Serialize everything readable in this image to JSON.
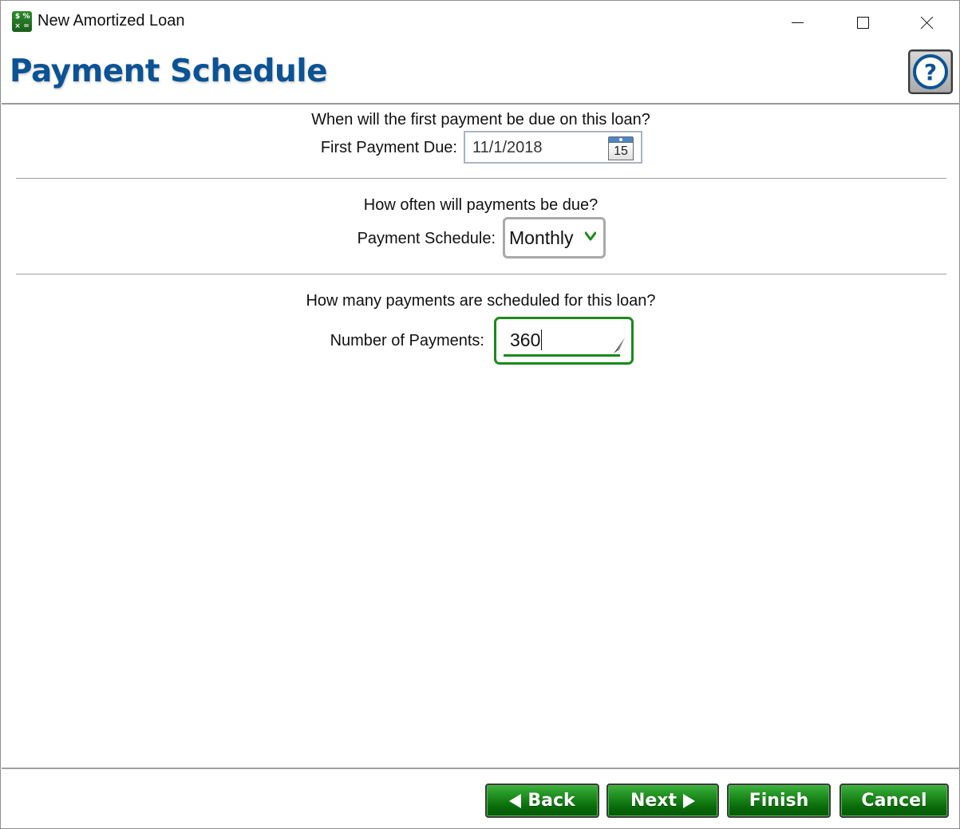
{
  "window": {
    "title": "New Amortized Loan",
    "app_icon_glyphs": [
      "$",
      "%",
      "×",
      "="
    ],
    "controls": {
      "minimize": "minimize-icon",
      "maximize": "maximize-icon",
      "close": "close-icon"
    }
  },
  "header": {
    "title": "Payment Schedule",
    "help_icon": "?"
  },
  "sections": {
    "first_payment": {
      "question": "When will the first payment be due on this loan?",
      "label": "First Payment Due:",
      "value": "11/1/2018",
      "calendar_icon_day": "15"
    },
    "schedule": {
      "question": "How often will payments be due?",
      "label": "Payment Schedule:",
      "selected": "Monthly"
    },
    "count": {
      "question": "How many payments are scheduled for this loan?",
      "label": "Number of Payments:",
      "value": "360"
    }
  },
  "footer": {
    "back_label": "Back",
    "next_label": "Next",
    "finish_label": "Finish",
    "cancel_label": "Cancel"
  },
  "colors": {
    "title_blue": "#0b5394",
    "accent_green": "#1a8a1a",
    "button_green": "#0a6b0a"
  }
}
